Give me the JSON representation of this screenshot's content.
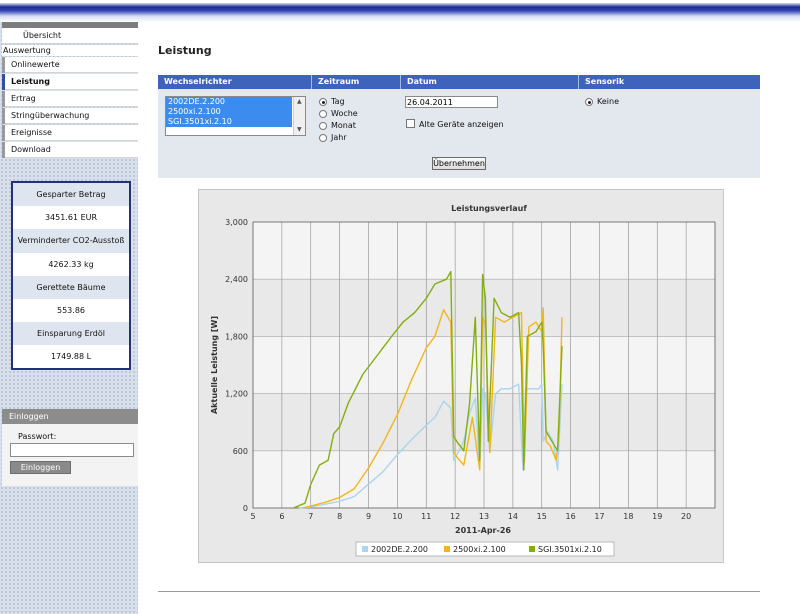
{
  "sidebar": {
    "top_item": "Übersicht",
    "section": "Auswertung",
    "items": [
      {
        "label": "Onlinewerte",
        "active": false
      },
      {
        "label": "Leistung",
        "active": true
      },
      {
        "label": "Ertrag",
        "active": false
      },
      {
        "label": "Stringüberwachung",
        "active": false
      },
      {
        "label": "Ereignisse",
        "active": false
      },
      {
        "label": "Download",
        "active": false
      }
    ],
    "stats": [
      {
        "label": "Gesparter Betrag",
        "value": "3451.61 EUR"
      },
      {
        "label": "Verminderter CO2-Ausstoß",
        "value": "4262.33 kg"
      },
      {
        "label": "Gerettete Bäume",
        "value": "553.86"
      },
      {
        "label": "Einsparung Erdöl",
        "value": "1749.88 L"
      }
    ],
    "login": {
      "heading": "Einloggen",
      "password_label": "Passwort:",
      "password_value": "",
      "button_label": "Einloggen"
    }
  },
  "main": {
    "title": "Leistung",
    "filter": {
      "headers": [
        "Wechselrichter",
        "Zeitraum",
        "Datum",
        "Sensorik"
      ],
      "inverters": [
        "2002DE.2.200",
        "2500xi.2.100",
        "SGI.3501xi.2.10"
      ],
      "periods": [
        {
          "label": "Tag",
          "checked": true
        },
        {
          "label": "Woche",
          "checked": false
        },
        {
          "label": "Monat",
          "checked": false
        },
        {
          "label": "Jahr",
          "checked": false
        }
      ],
      "date": "26.04.2011",
      "old_devices_label": "Alte Geräte anzeigen",
      "old_devices_checked": false,
      "sensor": {
        "label": "Keine",
        "checked": true
      },
      "submit_label": "Übernehmen"
    }
  },
  "chart_data": {
    "type": "line",
    "title": "Leistungsverlauf",
    "xlabel": "2011-Apr-26",
    "ylabel": "Aktuelle Leistung [W]",
    "xlim": [
      5,
      21
    ],
    "ylim": [
      0,
      3000
    ],
    "xticks": [
      "5",
      "6",
      "7",
      "8",
      "9",
      "10",
      "11",
      "12",
      "13",
      "14",
      "15",
      "16",
      "17",
      "18",
      "19",
      "20"
    ],
    "yticks": [
      "0",
      "600",
      "1,200",
      "1,800",
      "2,400",
      "3,000"
    ],
    "ytick_values": [
      0,
      600,
      1200,
      1800,
      2400,
      3000
    ],
    "grid": true,
    "legend_position": "bottom",
    "series": [
      {
        "name": "2002DE.2.200",
        "color": "#a9d4f2",
        "points": [
          [
            6.6,
            0
          ],
          [
            7.0,
            10
          ],
          [
            7.5,
            40
          ],
          [
            8.0,
            70
          ],
          [
            8.5,
            120
          ],
          [
            9.0,
            250
          ],
          [
            9.5,
            380
          ],
          [
            10.0,
            560
          ],
          [
            10.5,
            720
          ],
          [
            11.0,
            870
          ],
          [
            11.3,
            950
          ],
          [
            11.6,
            1120
          ],
          [
            11.85,
            1050
          ],
          [
            11.95,
            500
          ],
          [
            12.1,
            580
          ],
          [
            12.3,
            700
          ],
          [
            12.5,
            1000
          ],
          [
            12.7,
            1150
          ],
          [
            12.85,
            420
          ],
          [
            12.95,
            1250
          ],
          [
            13.05,
            1200
          ],
          [
            13.2,
            600
          ],
          [
            13.4,
            1200
          ],
          [
            13.6,
            1250
          ],
          [
            13.9,
            1250
          ],
          [
            14.2,
            1300
          ],
          [
            14.35,
            400
          ],
          [
            14.45,
            1250
          ],
          [
            14.7,
            1250
          ],
          [
            14.9,
            1250
          ],
          [
            15.0,
            1300
          ],
          [
            15.05,
            700
          ],
          [
            15.2,
            800
          ],
          [
            15.4,
            700
          ],
          [
            15.55,
            400
          ],
          [
            15.7,
            1300
          ]
        ]
      },
      {
        "name": "2500xi.2.100",
        "color": "#f2b61b",
        "points": [
          [
            6.7,
            0
          ],
          [
            7.0,
            20
          ],
          [
            7.5,
            60
          ],
          [
            8.0,
            110
          ],
          [
            8.5,
            200
          ],
          [
            9.0,
            420
          ],
          [
            9.5,
            680
          ],
          [
            10.0,
            980
          ],
          [
            10.5,
            1350
          ],
          [
            11.0,
            1680
          ],
          [
            11.3,
            1800
          ],
          [
            11.6,
            2080
          ],
          [
            11.85,
            1950
          ],
          [
            11.95,
            580
          ],
          [
            12.1,
            520
          ],
          [
            12.3,
            450
          ],
          [
            12.6,
            950
          ],
          [
            12.85,
            400
          ],
          [
            12.95,
            2000
          ],
          [
            13.05,
            1950
          ],
          [
            13.2,
            580
          ],
          [
            13.4,
            2000
          ],
          [
            13.7,
            1950
          ],
          [
            14.0,
            2000
          ],
          [
            14.3,
            2050
          ],
          [
            14.4,
            480
          ],
          [
            14.55,
            1900
          ],
          [
            14.8,
            1950
          ],
          [
            15.0,
            1850
          ],
          [
            15.05,
            2100
          ],
          [
            15.15,
            700
          ],
          [
            15.3,
            650
          ],
          [
            15.5,
            500
          ],
          [
            15.6,
            800
          ],
          [
            15.7,
            2000
          ]
        ]
      },
      {
        "name": "SGI.3501xi.2.10",
        "color": "#84ad10",
        "points": [
          [
            6.4,
            0
          ],
          [
            6.8,
            50
          ],
          [
            7.0,
            250
          ],
          [
            7.3,
            450
          ],
          [
            7.6,
            500
          ],
          [
            7.8,
            780
          ],
          [
            8.0,
            850
          ],
          [
            8.3,
            1100
          ],
          [
            8.8,
            1400
          ],
          [
            9.3,
            1600
          ],
          [
            9.8,
            1800
          ],
          [
            10.2,
            1950
          ],
          [
            10.6,
            2050
          ],
          [
            11.0,
            2200
          ],
          [
            11.3,
            2350
          ],
          [
            11.7,
            2400
          ],
          [
            11.85,
            2480
          ],
          [
            11.95,
            750
          ],
          [
            12.1,
            680
          ],
          [
            12.3,
            600
          ],
          [
            12.5,
            1100
          ],
          [
            12.7,
            2000
          ],
          [
            12.85,
            500
          ],
          [
            12.95,
            2450
          ],
          [
            13.05,
            2200
          ],
          [
            13.15,
            700
          ],
          [
            13.35,
            2200
          ],
          [
            13.6,
            2050
          ],
          [
            13.9,
            2000
          ],
          [
            14.2,
            2050
          ],
          [
            14.3,
            1500
          ],
          [
            14.38,
            400
          ],
          [
            14.5,
            1800
          ],
          [
            14.8,
            1850
          ],
          [
            15.0,
            1950
          ],
          [
            15.05,
            1700
          ],
          [
            15.15,
            800
          ],
          [
            15.35,
            700
          ],
          [
            15.55,
            600
          ],
          [
            15.7,
            1700
          ]
        ]
      }
    ]
  }
}
